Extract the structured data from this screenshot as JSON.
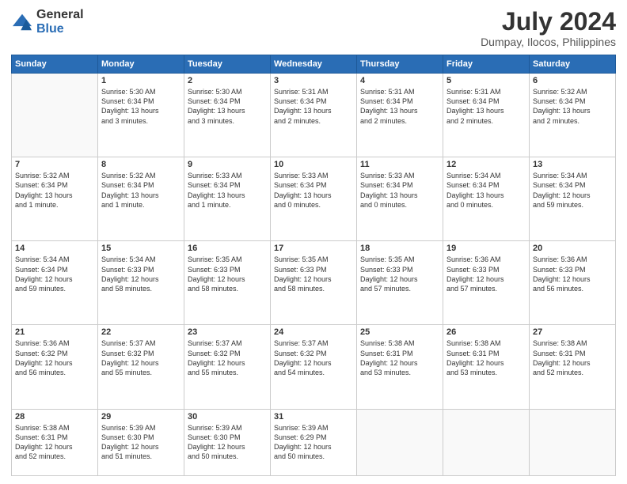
{
  "header": {
    "logo_line1": "General",
    "logo_line2": "Blue",
    "month": "July 2024",
    "location": "Dumpay, Ilocos, Philippines"
  },
  "weekdays": [
    "Sunday",
    "Monday",
    "Tuesday",
    "Wednesday",
    "Thursday",
    "Friday",
    "Saturday"
  ],
  "weeks": [
    [
      {
        "day": "",
        "info": ""
      },
      {
        "day": "1",
        "info": "Sunrise: 5:30 AM\nSunset: 6:34 PM\nDaylight: 13 hours\nand 3 minutes."
      },
      {
        "day": "2",
        "info": "Sunrise: 5:30 AM\nSunset: 6:34 PM\nDaylight: 13 hours\nand 3 minutes."
      },
      {
        "day": "3",
        "info": "Sunrise: 5:31 AM\nSunset: 6:34 PM\nDaylight: 13 hours\nand 2 minutes."
      },
      {
        "day": "4",
        "info": "Sunrise: 5:31 AM\nSunset: 6:34 PM\nDaylight: 13 hours\nand 2 minutes."
      },
      {
        "day": "5",
        "info": "Sunrise: 5:31 AM\nSunset: 6:34 PM\nDaylight: 13 hours\nand 2 minutes."
      },
      {
        "day": "6",
        "info": "Sunrise: 5:32 AM\nSunset: 6:34 PM\nDaylight: 13 hours\nand 2 minutes."
      }
    ],
    [
      {
        "day": "7",
        "info": "Sunrise: 5:32 AM\nSunset: 6:34 PM\nDaylight: 13 hours\nand 1 minute."
      },
      {
        "day": "8",
        "info": "Sunrise: 5:32 AM\nSunset: 6:34 PM\nDaylight: 13 hours\nand 1 minute."
      },
      {
        "day": "9",
        "info": "Sunrise: 5:33 AM\nSunset: 6:34 PM\nDaylight: 13 hours\nand 1 minute."
      },
      {
        "day": "10",
        "info": "Sunrise: 5:33 AM\nSunset: 6:34 PM\nDaylight: 13 hours\nand 0 minutes."
      },
      {
        "day": "11",
        "info": "Sunrise: 5:33 AM\nSunset: 6:34 PM\nDaylight: 13 hours\nand 0 minutes."
      },
      {
        "day": "12",
        "info": "Sunrise: 5:34 AM\nSunset: 6:34 PM\nDaylight: 13 hours\nand 0 minutes."
      },
      {
        "day": "13",
        "info": "Sunrise: 5:34 AM\nSunset: 6:34 PM\nDaylight: 12 hours\nand 59 minutes."
      }
    ],
    [
      {
        "day": "14",
        "info": "Sunrise: 5:34 AM\nSunset: 6:34 PM\nDaylight: 12 hours\nand 59 minutes."
      },
      {
        "day": "15",
        "info": "Sunrise: 5:34 AM\nSunset: 6:33 PM\nDaylight: 12 hours\nand 58 minutes."
      },
      {
        "day": "16",
        "info": "Sunrise: 5:35 AM\nSunset: 6:33 PM\nDaylight: 12 hours\nand 58 minutes."
      },
      {
        "day": "17",
        "info": "Sunrise: 5:35 AM\nSunset: 6:33 PM\nDaylight: 12 hours\nand 58 minutes."
      },
      {
        "day": "18",
        "info": "Sunrise: 5:35 AM\nSunset: 6:33 PM\nDaylight: 12 hours\nand 57 minutes."
      },
      {
        "day": "19",
        "info": "Sunrise: 5:36 AM\nSunset: 6:33 PM\nDaylight: 12 hours\nand 57 minutes."
      },
      {
        "day": "20",
        "info": "Sunrise: 5:36 AM\nSunset: 6:33 PM\nDaylight: 12 hours\nand 56 minutes."
      }
    ],
    [
      {
        "day": "21",
        "info": "Sunrise: 5:36 AM\nSunset: 6:32 PM\nDaylight: 12 hours\nand 56 minutes."
      },
      {
        "day": "22",
        "info": "Sunrise: 5:37 AM\nSunset: 6:32 PM\nDaylight: 12 hours\nand 55 minutes."
      },
      {
        "day": "23",
        "info": "Sunrise: 5:37 AM\nSunset: 6:32 PM\nDaylight: 12 hours\nand 55 minutes."
      },
      {
        "day": "24",
        "info": "Sunrise: 5:37 AM\nSunset: 6:32 PM\nDaylight: 12 hours\nand 54 minutes."
      },
      {
        "day": "25",
        "info": "Sunrise: 5:38 AM\nSunset: 6:31 PM\nDaylight: 12 hours\nand 53 minutes."
      },
      {
        "day": "26",
        "info": "Sunrise: 5:38 AM\nSunset: 6:31 PM\nDaylight: 12 hours\nand 53 minutes."
      },
      {
        "day": "27",
        "info": "Sunrise: 5:38 AM\nSunset: 6:31 PM\nDaylight: 12 hours\nand 52 minutes."
      }
    ],
    [
      {
        "day": "28",
        "info": "Sunrise: 5:38 AM\nSunset: 6:31 PM\nDaylight: 12 hours\nand 52 minutes."
      },
      {
        "day": "29",
        "info": "Sunrise: 5:39 AM\nSunset: 6:30 PM\nDaylight: 12 hours\nand 51 minutes."
      },
      {
        "day": "30",
        "info": "Sunrise: 5:39 AM\nSunset: 6:30 PM\nDaylight: 12 hours\nand 50 minutes."
      },
      {
        "day": "31",
        "info": "Sunrise: 5:39 AM\nSunset: 6:29 PM\nDaylight: 12 hours\nand 50 minutes."
      },
      {
        "day": "",
        "info": ""
      },
      {
        "day": "",
        "info": ""
      },
      {
        "day": "",
        "info": ""
      }
    ]
  ]
}
